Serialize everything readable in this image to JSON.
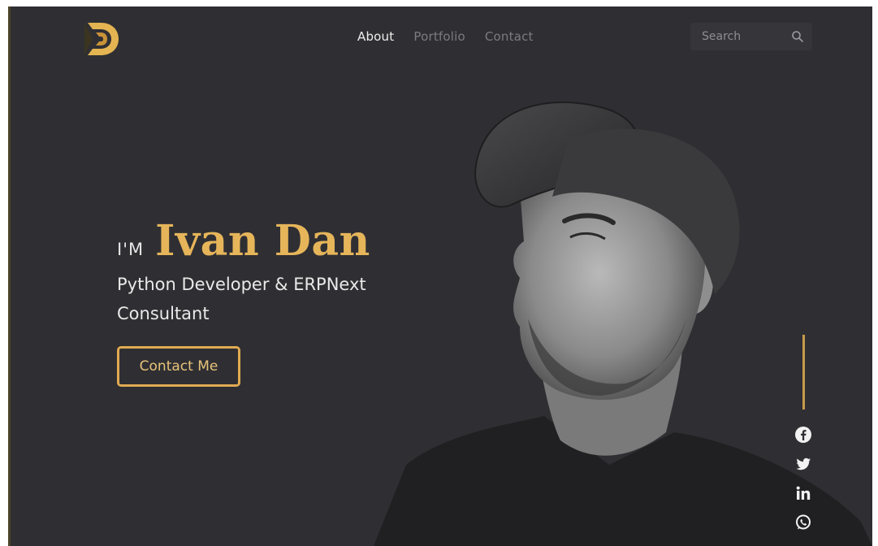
{
  "nav": {
    "items": [
      {
        "label": "About",
        "active": true
      },
      {
        "label": "Portfolio",
        "active": false
      },
      {
        "label": "Contact",
        "active": false
      }
    ]
  },
  "search": {
    "placeholder": "Search",
    "icon": "search-icon"
  },
  "hero": {
    "prefix": "I'M",
    "name": "Ivan Dan",
    "role": "Python Developer & ERPNext Consultant",
    "cta_label": "Contact Me"
  },
  "social": {
    "icons": [
      "facebook-icon",
      "twitter-icon",
      "linkedin-icon",
      "whatsapp-icon"
    ]
  },
  "colors": {
    "background": "#2f2f33",
    "accent": "#e6b55a",
    "text": "#e9e9e9",
    "nav_inactive": "#7b7b80"
  }
}
